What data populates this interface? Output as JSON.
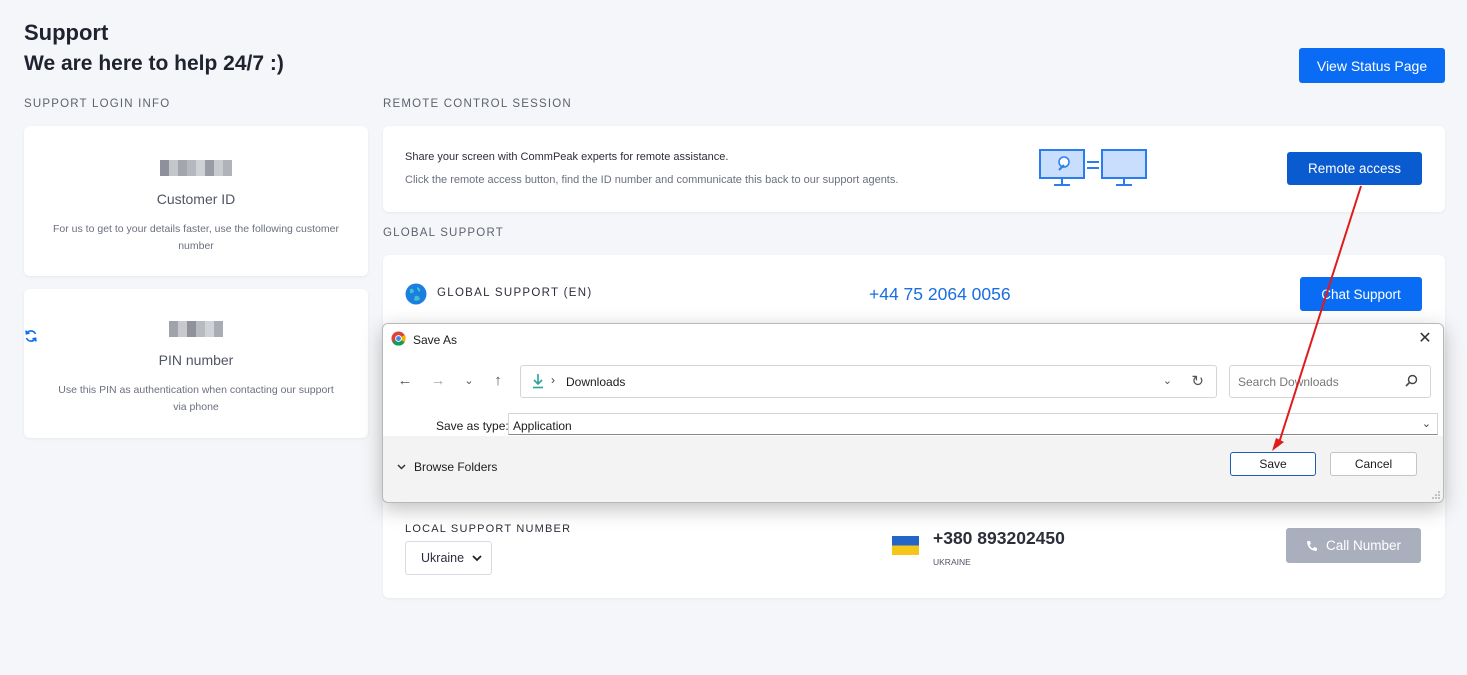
{
  "header": {
    "title": "Support",
    "subtitle": "We are here to help 24/7 :)",
    "status_button": "View Status Page"
  },
  "sections": {
    "login_info": "SUPPORT LOGIN INFO",
    "remote_session": "REMOTE CONTROL SESSION",
    "global_support": "GLOBAL SUPPORT"
  },
  "customer_card": {
    "label": "Customer ID",
    "note": "For us to get to your details faster, use the following customer number"
  },
  "pin_card": {
    "label": "PIN number",
    "note": "Use this PIN as authentication when contacting our support via phone"
  },
  "remote": {
    "line1": "Share your screen with CommPeak experts for remote assistance.",
    "line2": "Click the remote access button, find the ID number and communicate this back to our support agents.",
    "button": "Remote access"
  },
  "global": {
    "label": "GLOBAL SUPPORT (EN)",
    "phone": "+44 75 2064 0056",
    "button": "Chat Support"
  },
  "local": {
    "label": "LOCAL SUPPORT NUMBER",
    "country_selected": "Ukraine",
    "phone": "+380 893202450",
    "country_caption": "UKRAINE",
    "button": "Call Number"
  },
  "dialog": {
    "title": "Save As",
    "address": "Downloads",
    "search_placeholder": "Search Downloads",
    "type_label": "Save as type:",
    "type_value": "Application",
    "browse": "Browse Folders",
    "save": "Save",
    "cancel": "Cancel"
  },
  "colors": {
    "primary": "#0a6cf5",
    "annotation_arrow": "#e01b1b"
  }
}
